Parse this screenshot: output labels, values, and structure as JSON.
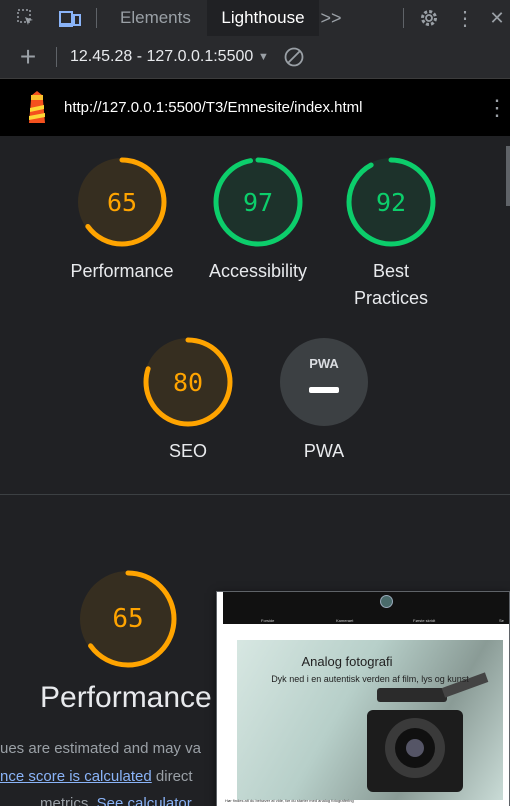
{
  "devtools": {
    "tabs": [
      "Elements",
      "Lighthouse"
    ],
    "active_tab": "Lighthouse",
    "more_label": ">>",
    "menu_label": "⋮",
    "close_label": "✕"
  },
  "runbar": {
    "add_label": "+",
    "report_select": "12.45.28 - 127.0.0.1:5500",
    "dropdown_label": "▼"
  },
  "report": {
    "url": "http://127.0.0.1:5500/T3/Emnesite/index.html",
    "url_menu_label": "⋮",
    "gauges": [
      {
        "score": "65",
        "value": 65,
        "label": "Performance",
        "color": "#ffa400"
      },
      {
        "score": "97",
        "value": 97,
        "label": "Accessibility",
        "color": "#0cce6b"
      },
      {
        "score": "92",
        "value": 92,
        "label": "Best Practices",
        "color": "#0cce6b"
      },
      {
        "score": "80",
        "value": 80,
        "label": "SEO",
        "color": "#ffa400"
      },
      {
        "score": "",
        "value": 0,
        "label": "PWA",
        "color": "#9aa0a6"
      }
    ],
    "pwa_badge": "PWA",
    "performance": {
      "score": "65",
      "value": 65,
      "title": "Performance",
      "disclaimer_1": "ues are estimated and may va",
      "disclaimer_2_link": "nce score is calculated",
      "disclaimer_2_text": " direct",
      "disclaimer_3_text": "metrics. ",
      "disclaimer_3_link": "See calculator"
    },
    "screenshot": {
      "nav_items": [
        "Forside",
        "Kameraet",
        "Første skridt",
        "Se"
      ],
      "title": "Analog fotografi",
      "subtitle": "Dyk ned i en autentisk verden af film, lys og kunst",
      "small_text": "Hør findes alt du behøver at vide, før du starter med analog fotografering"
    }
  },
  "colors": {
    "pass": "#0cce6b",
    "average": "#ffa400",
    "accent": "#8ab4f8",
    "bg": "#202124"
  }
}
